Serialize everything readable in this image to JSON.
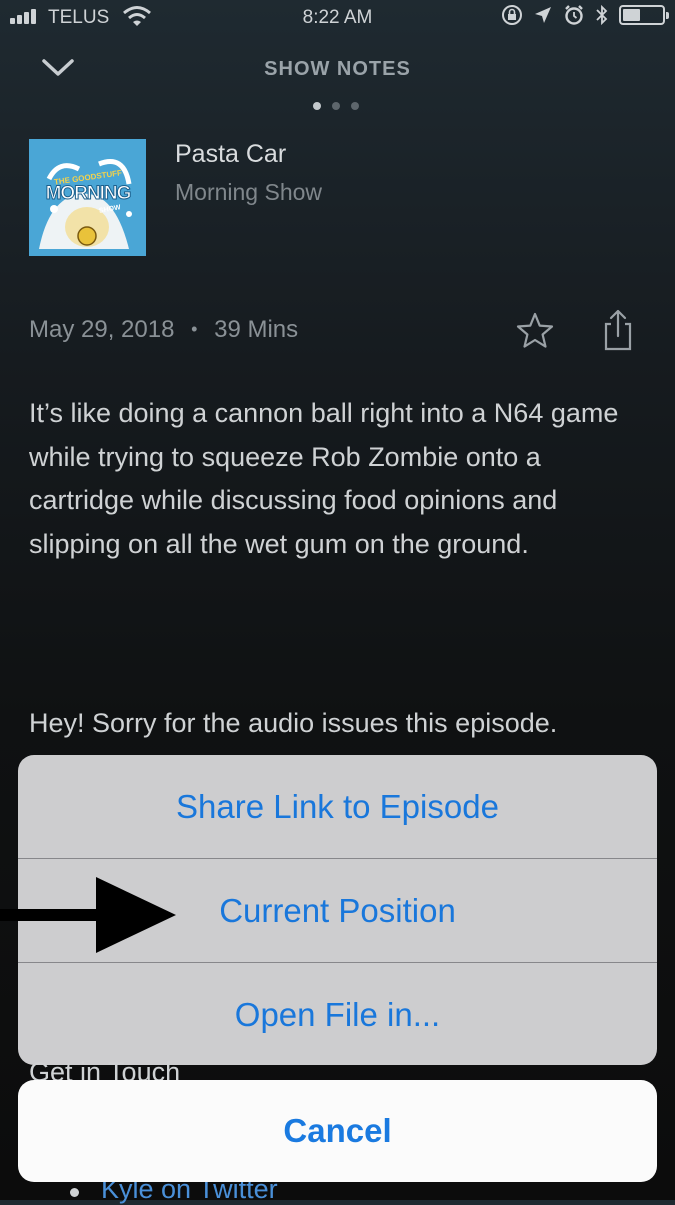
{
  "status_bar": {
    "carrier": "TELUS",
    "time": "8:22 AM",
    "battery_level": 0.45
  },
  "header": {
    "title": "SHOW NOTES",
    "page_dots": 3,
    "active_dot": 0
  },
  "episode": {
    "title": "Pasta Car",
    "podcast": "Morning Show",
    "date": "May 29, 2018",
    "separator": "•",
    "duration": "39 Mins",
    "artwork_text": [
      "THE GOODSTUFF",
      "MORNING",
      "SHOW"
    ]
  },
  "notes": {
    "paragraph1": "It’s like doing a cannon ball right into a N64 game while trying to squeeze Rob Zombie onto a cartridge while discussing food opinions and slipping on all the wet gum on the ground.",
    "paragraph2": "Hey! Sorry for the audio issues this episode.",
    "get_in_touch": "Get in Touch",
    "twitter_link": "Kyle on Twitter"
  },
  "action_sheet": {
    "items": [
      {
        "label": "Share Link to Episode"
      },
      {
        "label": "Current Position"
      },
      {
        "label": "Open File in..."
      }
    ],
    "cancel_label": "Cancel"
  },
  "icons": {
    "back": "chevron-down-icon",
    "favorite": "star-icon",
    "share": "share-icon",
    "annotation": "arrow-right-icon"
  },
  "colors": {
    "accent": "#1a7ae0",
    "link": "#4a90d9"
  }
}
